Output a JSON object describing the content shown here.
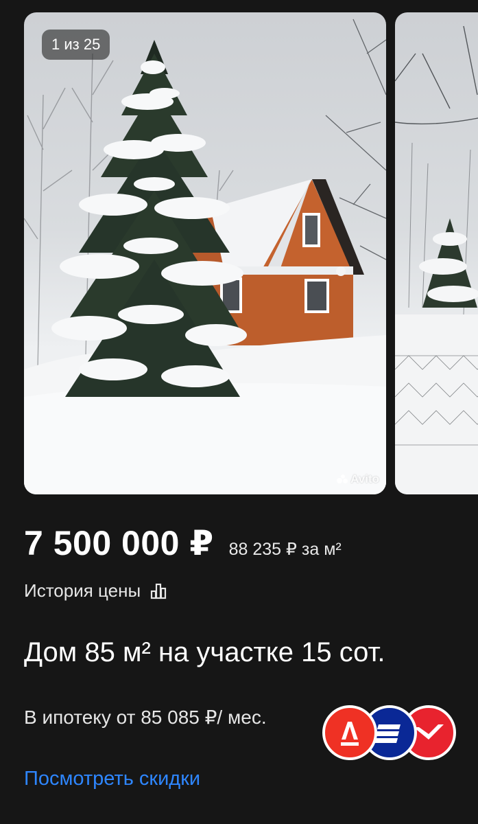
{
  "gallery": {
    "counter": "1 из 25",
    "watermark": "Avito",
    "current_photo": 1,
    "total_photos": 25
  },
  "listing": {
    "price": "7 500 000 ₽",
    "price_per_m2": "88 235 ₽ за м²",
    "price_history_label": "История цены",
    "title": "Дом 85 м² на участке 15 сот.",
    "mortgage_text": "В ипотеку от 85 085 ₽/ мес.",
    "discounts_link": "Посмотреть скидки"
  },
  "banks": [
    {
      "icon": "alfa-bank-icon",
      "color": "#ef3124"
    },
    {
      "icon": "vtb-bank-icon",
      "color": "#0a2896"
    },
    {
      "icon": "pochta-bank-icon",
      "color": "#e8232e"
    }
  ],
  "colors": {
    "background": "#161616",
    "text": "#ffffff",
    "link": "#2e86ff"
  }
}
